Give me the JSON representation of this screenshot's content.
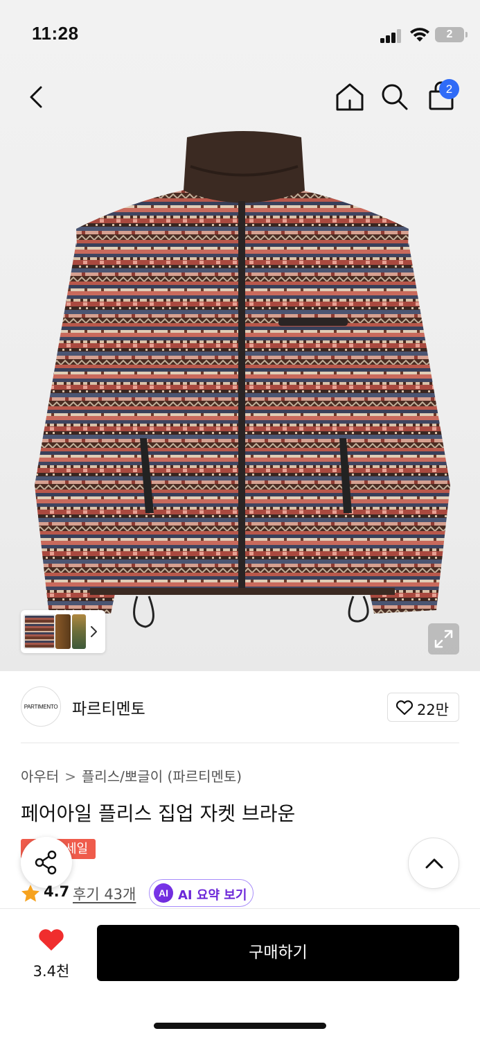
{
  "status_bar": {
    "time": "11:28",
    "battery": "2"
  },
  "nav": {
    "cart_count": "2"
  },
  "brand": {
    "logo_text": "PARTIMENTO",
    "name": "파르티멘토",
    "likes": "22만"
  },
  "breadcrumb": {
    "category": "아우터",
    "subcategory": "플리스/뽀글이 (파르티멘토)"
  },
  "product": {
    "title": "페어아일 플리스 집업 자켓 브라운",
    "sale_label": "세일",
    "rating": "4.7",
    "review_link": "후기 43개",
    "ai_badge": "AI",
    "ai_summary_label": "AI 요약 보기"
  },
  "bottom_bar": {
    "wish_count": "3.4천",
    "buy_label": "구매하기"
  },
  "colors": {
    "accent": "#2f6bf7",
    "sale": "#ef5b4b",
    "heart": "#f02d2d",
    "ai": "#6d28d9",
    "buy_button": "#000000"
  }
}
